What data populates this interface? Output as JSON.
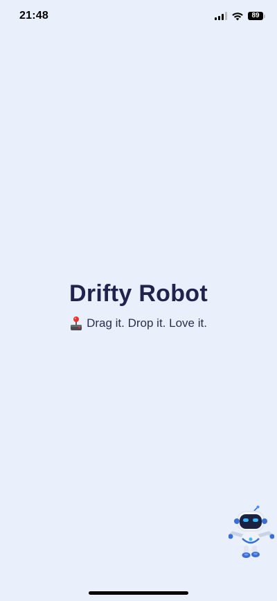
{
  "status_bar": {
    "time": "21:48",
    "battery": "89"
  },
  "main": {
    "title": "Drifty Robot",
    "subtitle": "Drag it. Drop it. Love it."
  },
  "icons": {
    "subtitle_icon": "joystick-icon",
    "robot": "robot-icon"
  },
  "colors": {
    "background": "#eaf0fb",
    "title": "#22224d",
    "robot_eyes": "#39b8ff"
  }
}
